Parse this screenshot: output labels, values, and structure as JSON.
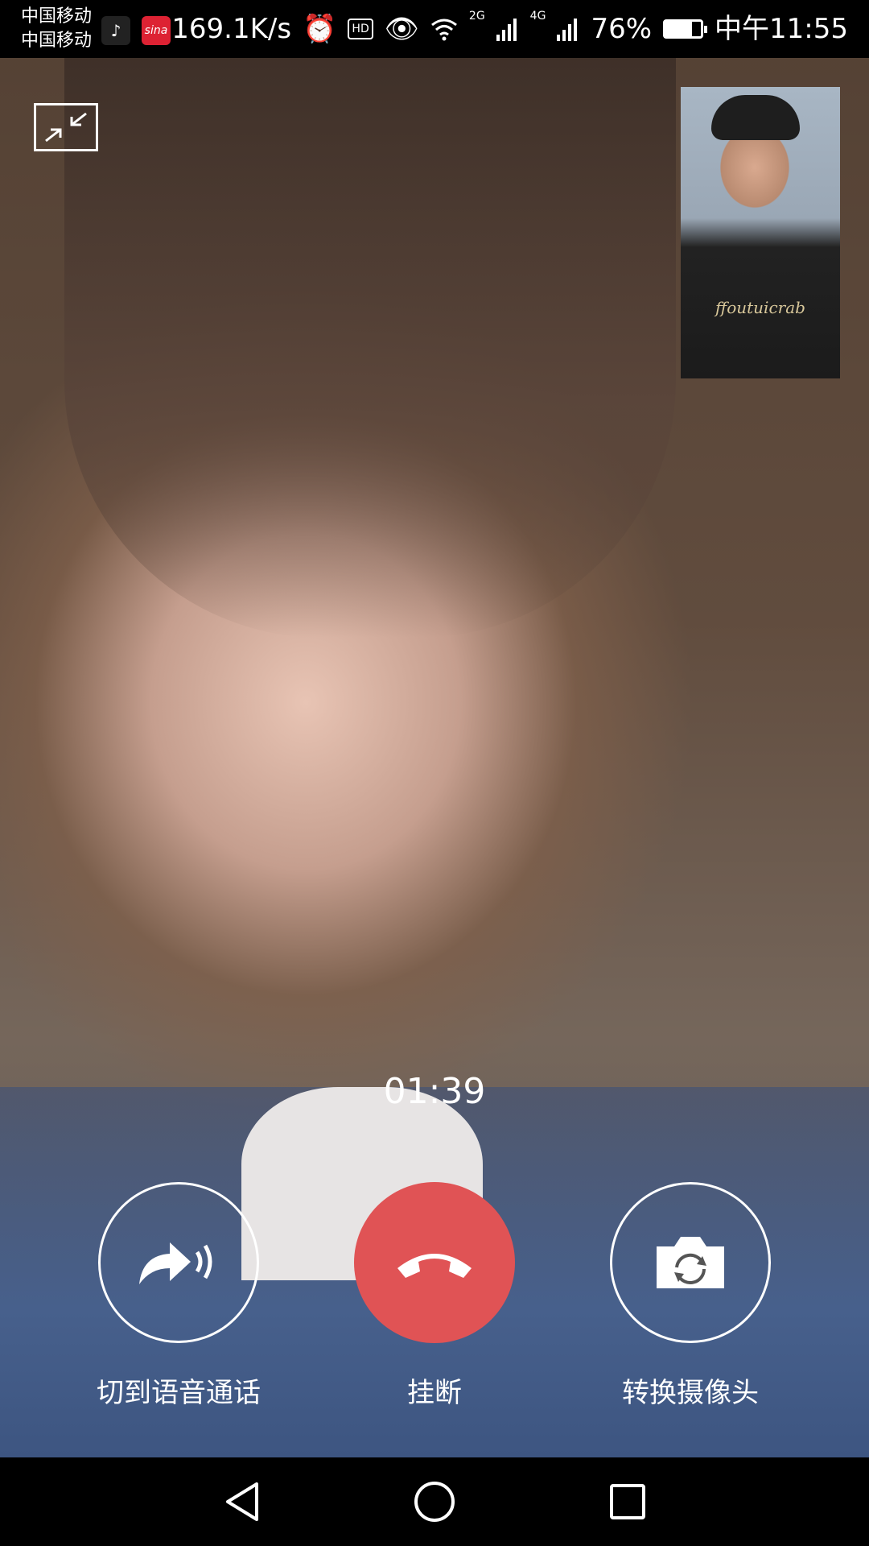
{
  "status_bar": {
    "carrier_1": "中国移动",
    "carrier_2": "中国移动",
    "app_icons": [
      "tiktok-icon",
      "sina-icon"
    ],
    "net_speed": "169.1K/s",
    "hd_label": "HD",
    "sim1_network": "2G",
    "sim2_network": "4G",
    "battery": "76%",
    "battery_level": 0.76,
    "time": "中午11:55"
  },
  "call": {
    "timer": "01:39",
    "pip_shirt_text": "ffoutuicrab"
  },
  "controls": {
    "voice_label": "切到语音通话",
    "hangup_label": "挂断",
    "switch_camera_label": "转换摄像头"
  },
  "colors": {
    "hangup_red": "#e05355",
    "status_bar_bg": "#000000"
  },
  "icons": {
    "collapse": "collapse-icon",
    "voice": "voice-call-icon",
    "hangup": "phone-hangup-icon",
    "camera": "camera-switch-icon",
    "back": "back-triangle-icon",
    "home": "home-circle-icon",
    "recent": "recent-square-icon"
  }
}
